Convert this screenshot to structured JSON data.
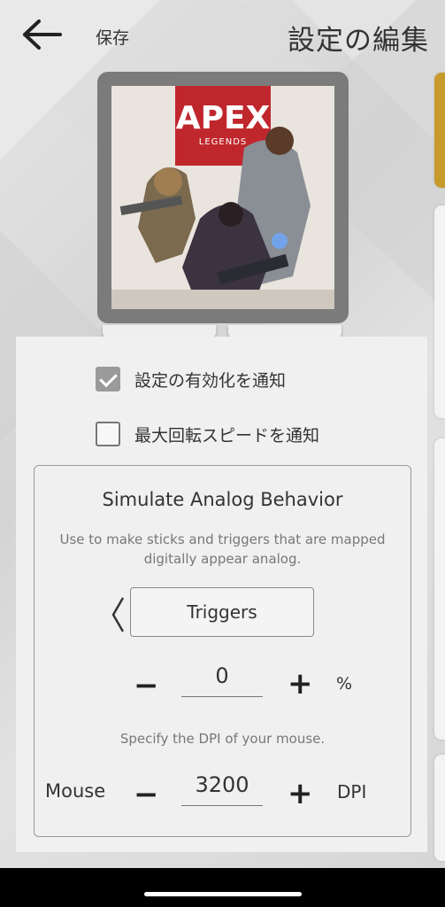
{
  "header": {
    "back_icon": "arrow-left-icon",
    "save_label": "保存",
    "title": "設定の編集"
  },
  "game": {
    "logo_main": "APEX",
    "logo_sub": "LEGENDS"
  },
  "options": {
    "notify_activation": {
      "label": "設定の有効化を通知",
      "checked": true
    },
    "notify_max_speed": {
      "label": "最大回転スピードを通知",
      "checked": false
    }
  },
  "analog": {
    "title": "Simulate Analog Behavior",
    "description": "Use to make sticks and triggers that are mapped digitally appear analog.",
    "prev_icon": "chevron-left-icon",
    "mode": "Triggers",
    "trigger_value": "0",
    "trigger_unit": "%",
    "minus": "−",
    "plus": "+",
    "dpi_hint": "Specify the DPI of your mouse.",
    "mouse_label": "Mouse",
    "mouse_value": "3200",
    "mouse_unit": "DPI"
  },
  "colors": {
    "accent_gold": "#c79a2c",
    "checkbox_checked": "#9a9a9a",
    "logo_red": "#c0272d"
  }
}
